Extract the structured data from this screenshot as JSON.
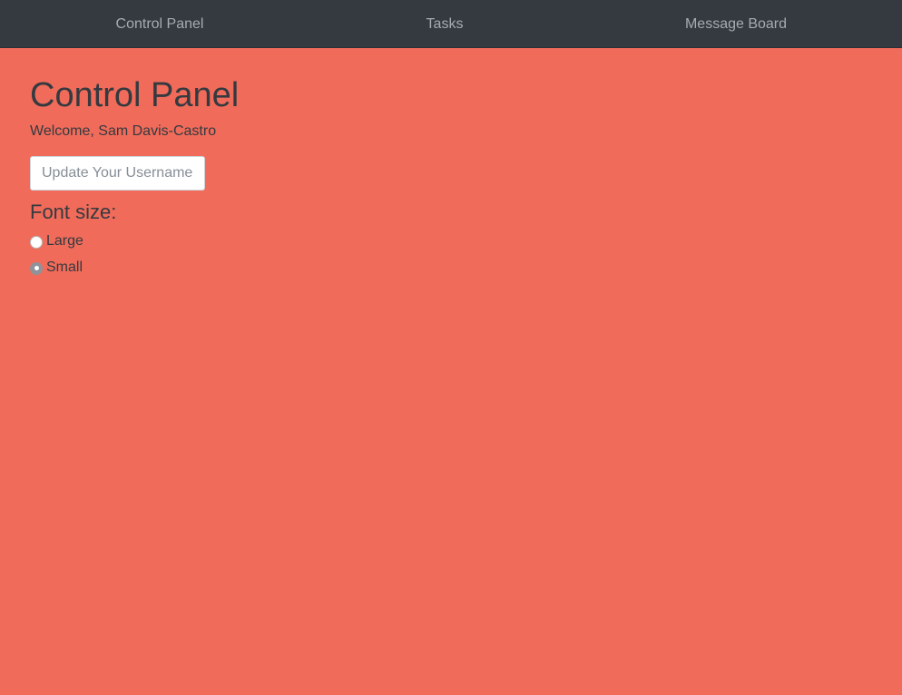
{
  "nav": {
    "items": [
      {
        "label": "Control Panel"
      },
      {
        "label": "Tasks"
      },
      {
        "label": "Message Board"
      }
    ]
  },
  "main": {
    "title": "Control Panel",
    "welcome_prefix": "Welcome, ",
    "user_name": "Sam Davis-Castro",
    "username_input": {
      "placeholder": "Update Your Username",
      "value": ""
    },
    "font_size": {
      "heading": "Font size:",
      "options": [
        {
          "label": "Large",
          "selected": false
        },
        {
          "label": "Small",
          "selected": true
        }
      ]
    }
  },
  "colors": {
    "background": "#f06b5a",
    "navbar": "#343a40",
    "nav_text": "#a7abaf",
    "text": "#343a40"
  }
}
